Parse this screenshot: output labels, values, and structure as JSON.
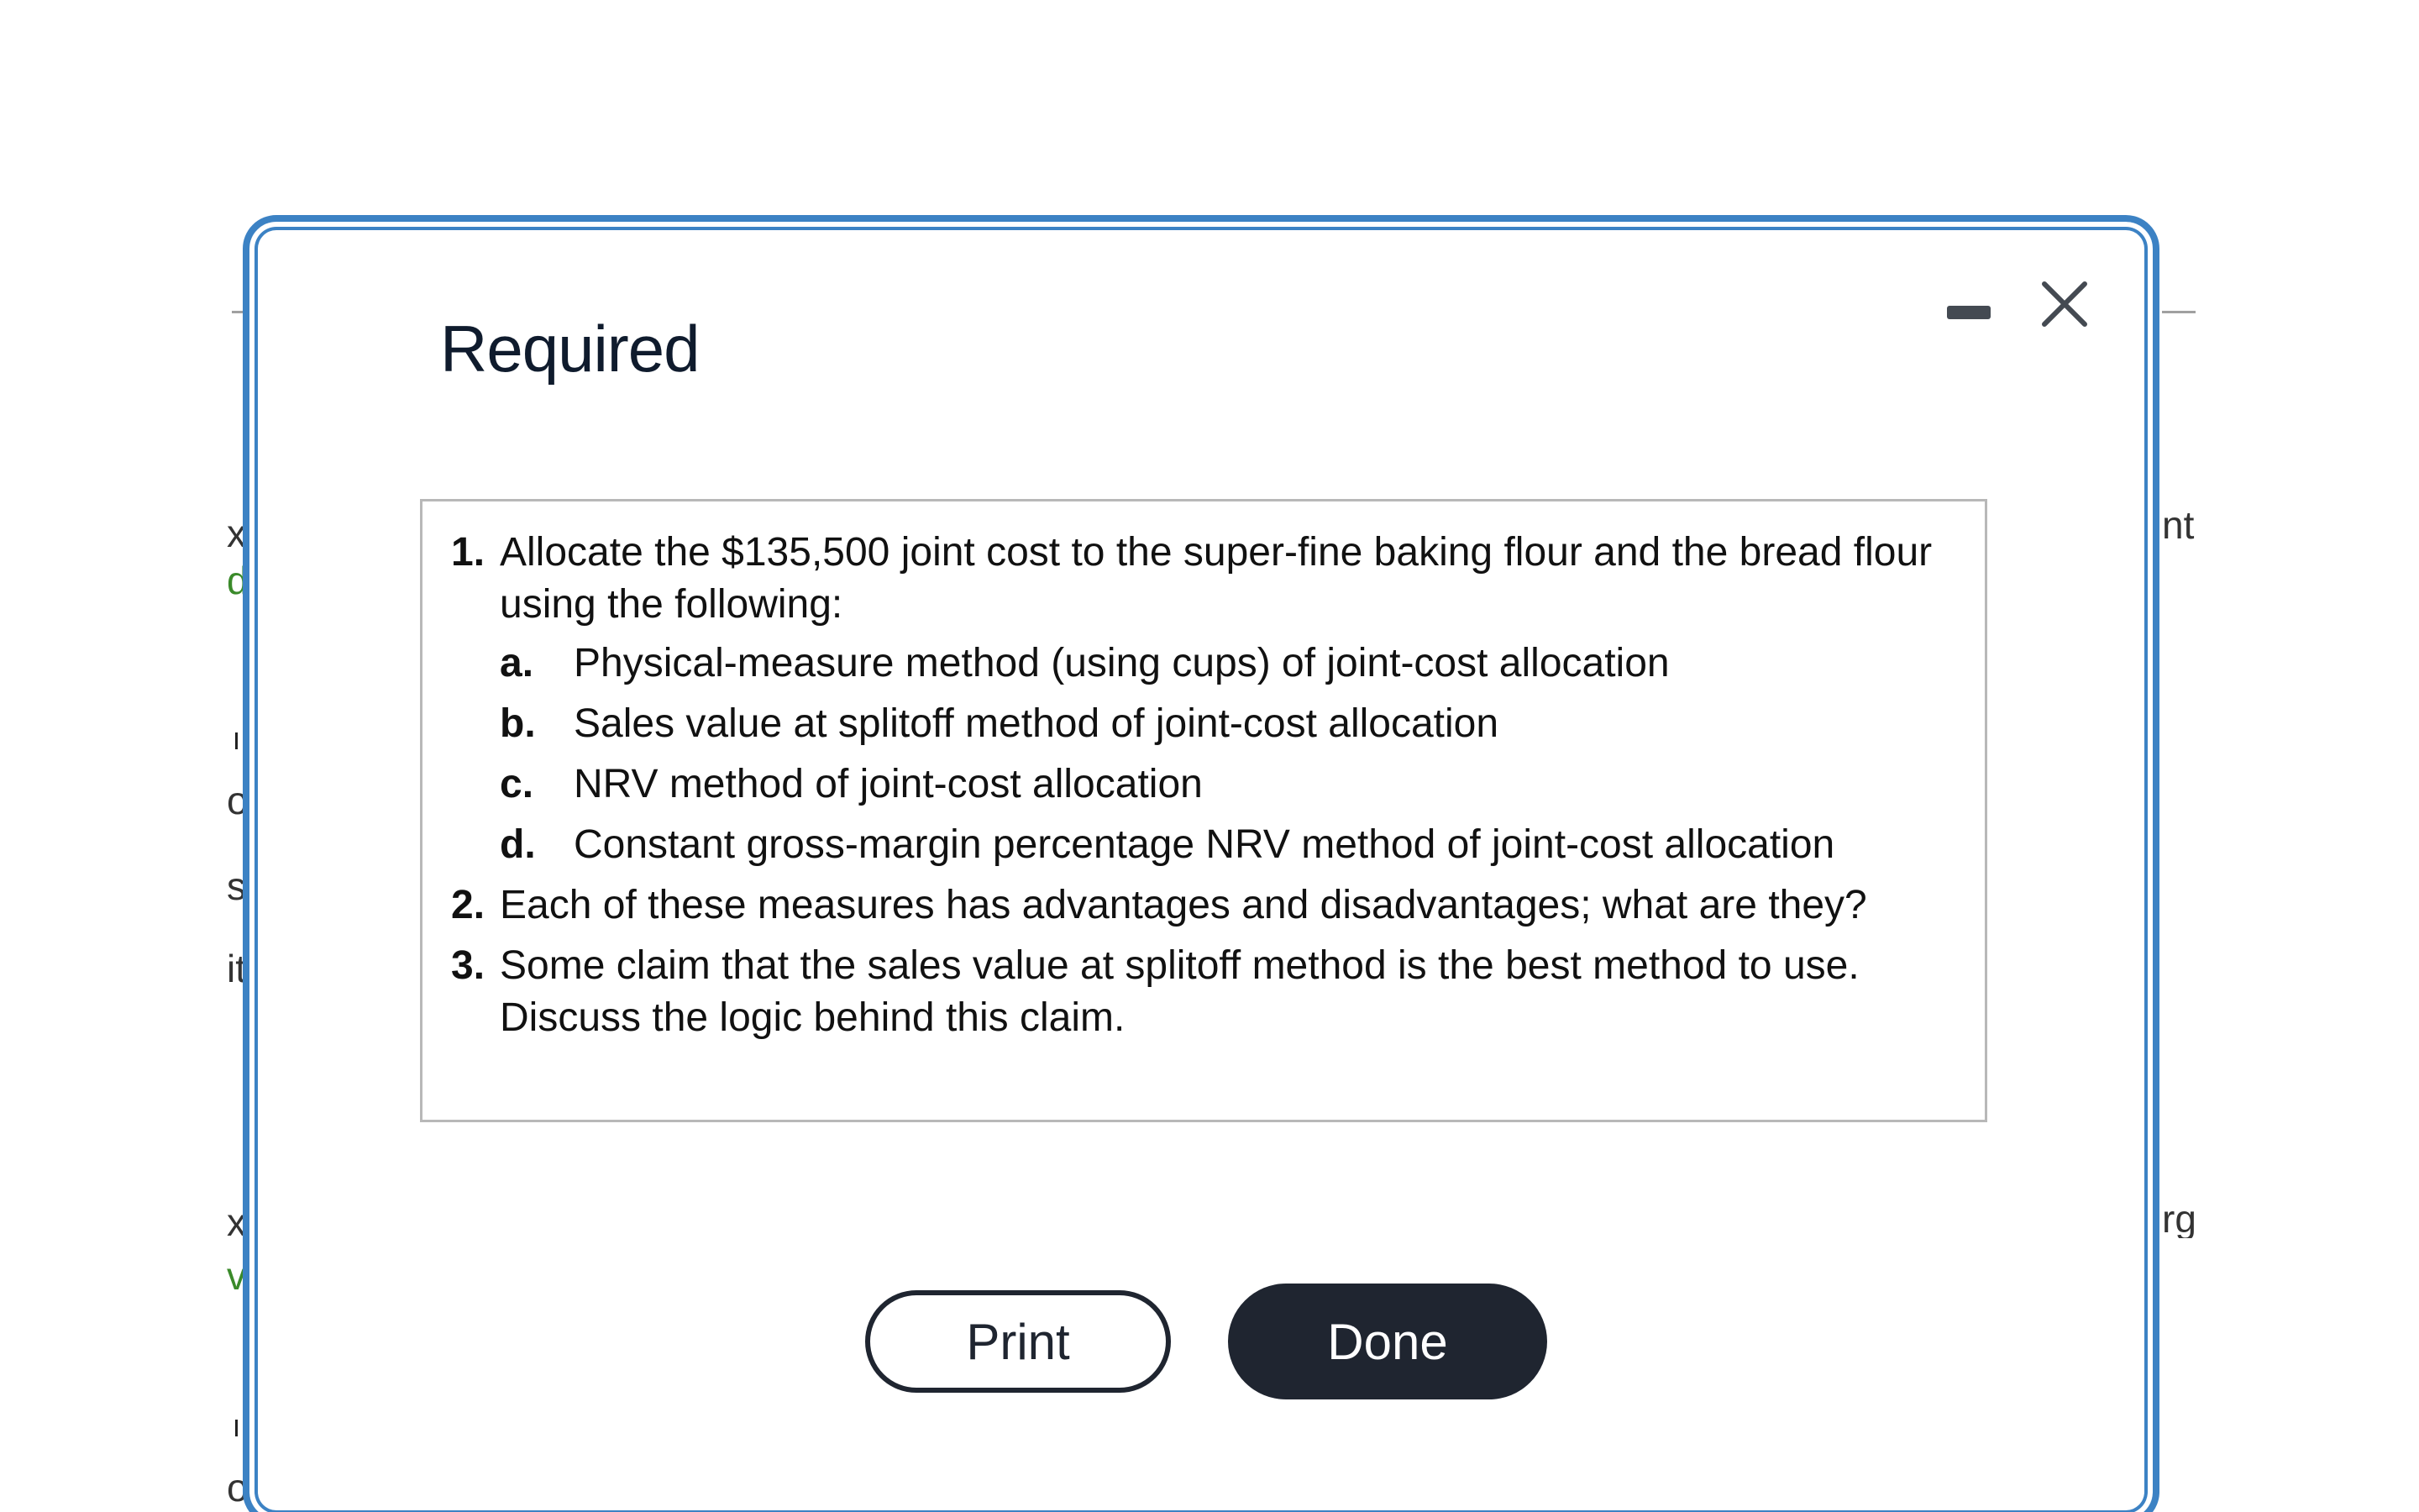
{
  "dialog": {
    "title": "Required",
    "minimize_icon": "minimize-icon",
    "close_icon": "close-icon"
  },
  "requirements": [
    {
      "number": "1.",
      "text": "Allocate the $135,500 joint cost to the super-fine baking flour and the bread flour using the following:",
      "sub_items": [
        {
          "letter": "a.",
          "text": "Physical-measure method (using cups) of joint-cost allocation"
        },
        {
          "letter": "b.",
          "text": "Sales value at splitoff method of joint-cost allocation"
        },
        {
          "letter": "c.",
          "text": "NRV method of joint-cost allocation"
        },
        {
          "letter": "d.",
          "text": "Constant gross-margin percentage NRV method of joint-cost allocation"
        }
      ]
    },
    {
      "number": "2.",
      "text": "Each of these measures has advantages and disadvantages; what are they?"
    },
    {
      "number": "3.",
      "text": "Some claim that the sales value at splitoff method is the best method to use. Discuss the logic behind this claim."
    }
  ],
  "buttons": {
    "print_label": "Print",
    "done_label": "Done"
  },
  "colors": {
    "dialog_border": "#3c82c4",
    "title_text": "#0f1b2d",
    "button_dark": "#1f2530",
    "panel_border": "#b8b8b8",
    "background_green_text": "#3a8a2a"
  },
  "background_fragments": {
    "left": [
      "x",
      "d",
      "o",
      "s",
      "it",
      "x",
      "v",
      "o"
    ],
    "right": [
      "nt",
      "rg"
    ]
  }
}
